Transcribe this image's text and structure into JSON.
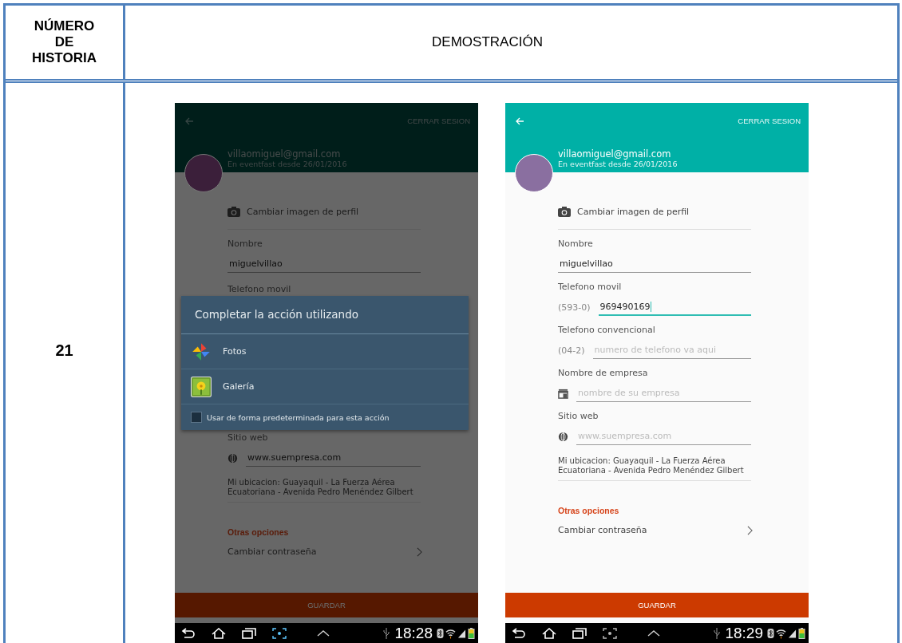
{
  "table": {
    "header": {
      "column_1": "NÚMERO DE HISTORIA",
      "column_2": "DEMOSTRACIÓN"
    },
    "rows": [
      {
        "number": "21",
        "screens": [
          {
            "dimmed": true,
            "header": {
              "action": "CERRAR SESION",
              "email": "villaomiguel@gmail.com",
              "since": "En eventfast desde 26/01/2016"
            },
            "items": [
              {
                "kind": "action",
                "label": "Cambiar imagen de perfil"
              },
              {
                "kind": "field",
                "label": "Nombre",
                "value": "miguelvillao",
                "focused": false
              },
              {
                "kind": "label",
                "label": "Telefono movil"
              },
              {
                "kind": "dialog",
                "title": "Completar la acción utilizando",
                "options": [
                  {
                    "kind": "photos",
                    "label": "Fotos"
                  },
                  {
                    "kind": "gallery",
                    "label": "Galería"
                  }
                ],
                "checkbox": {
                  "label": "Usar de forma predeterminada para esta acción",
                  "checked": false
                }
              },
              {
                "kind": "website",
                "label": "Sitio web",
                "placeholder": "www.suempresa.com",
                "focused": false
              },
              {
                "kind": "text",
                "text": "Mi ubicacion: Guayaquil - La Fuerza Aérea Ecuatoriana - Avenida Pedro Menéndez Gilbert"
              },
              {
                "kind": "section",
                "label": "Otras opciones"
              },
              {
                "kind": "link",
                "label": "Cambiar contraseña"
              }
            ],
            "save": "GUARDAR",
            "status": {
              "time": "18:28",
              "capture_active": true
            }
          },
          {
            "dimmed": false,
            "header": {
              "action": "CERRAR SESION",
              "email": "villaomiguel@gmail.com",
              "since": "En eventfast desde 26/01/2016"
            },
            "items": [
              {
                "kind": "action",
                "label": "Cambiar imagen de perfil"
              },
              {
                "kind": "field",
                "label": "Nombre",
                "value": "miguelvillao",
                "focused": false
              },
              {
                "kind": "field",
                "label": "Telefono movil",
                "prefix": "(593-0)",
                "value": "969490169",
                "focused": true
              },
              {
                "kind": "field",
                "label": "Telefono convencional",
                "prefix": "(04-2)",
                "placeholder": "numero de telefono va aqui",
                "focused": false
              },
              {
                "kind": "company",
                "label": "Nombre de empresa",
                "placeholder": "nombre de su empresa",
                "focused": false
              },
              {
                "kind": "website",
                "label": "Sitio web",
                "placeholder": "www.suempresa.com",
                "focused": false
              },
              {
                "kind": "text",
                "text": "Mi ubicacion: Guayaquil - La Fuerza Aérea Ecuatoriana - Avenida Pedro Menéndez Gilbert"
              },
              {
                "kind": "section",
                "label": "Otras opciones"
              },
              {
                "kind": "link",
                "label": "Cambiar contraseña"
              }
            ],
            "save": "GUARDAR",
            "status": {
              "time": "18:29",
              "capture_active": false
            }
          }
        ]
      }
    ]
  }
}
